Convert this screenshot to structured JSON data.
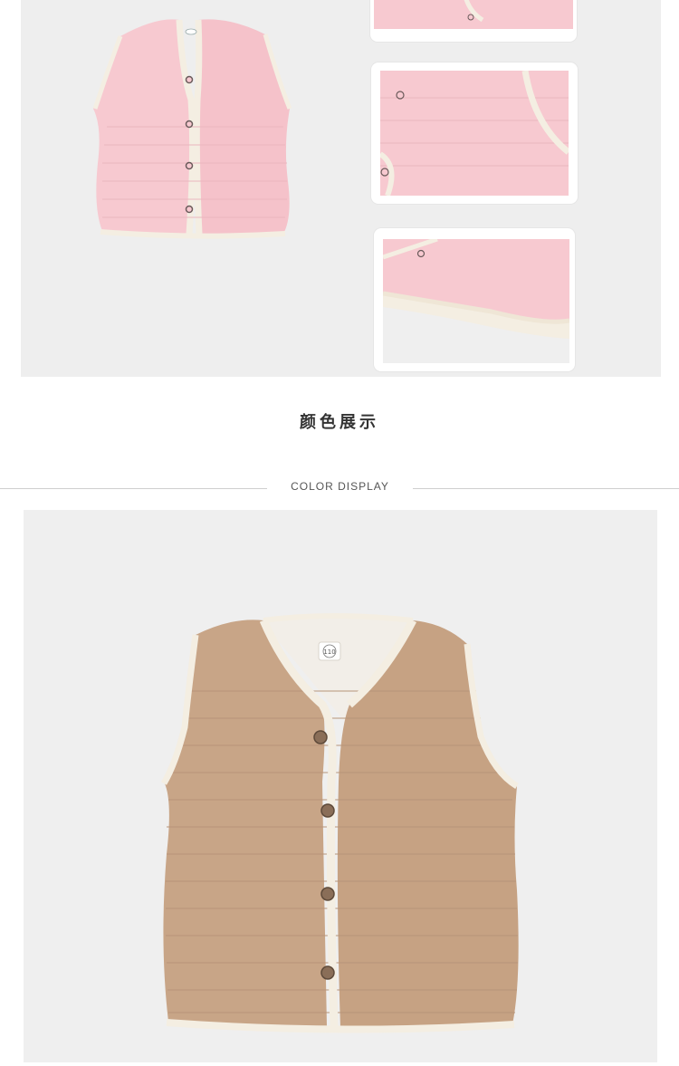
{
  "section": {
    "title": "颜色展示",
    "subtitle": "COLOR DISPLAY"
  },
  "colors": {
    "pink": "#f7c9d0",
    "brown": "#c8a587",
    "trim": "#f4eee2",
    "panel": "#eeeeee"
  },
  "main_product": {
    "size_tag": "110"
  }
}
